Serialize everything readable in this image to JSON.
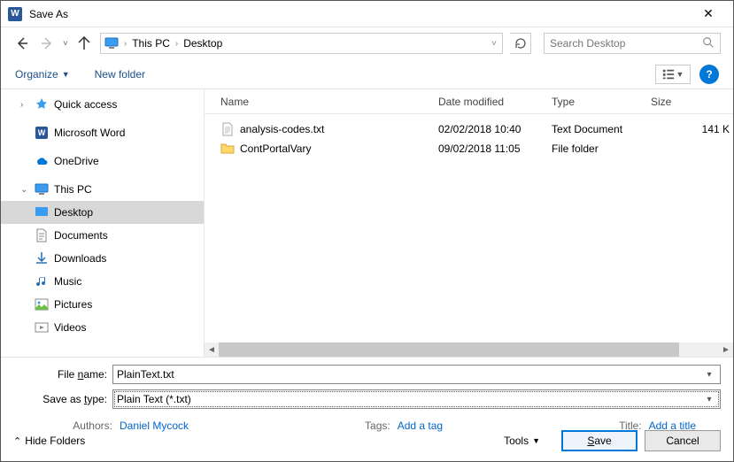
{
  "window": {
    "title": "Save As"
  },
  "nav": {
    "breadcrumb": [
      "This PC",
      "Desktop"
    ],
    "search_placeholder": "Search Desktop"
  },
  "toolbar": {
    "organize": "Organize",
    "newfolder": "New folder"
  },
  "sidebar": {
    "quickaccess": "Quick access",
    "word": "Microsoft Word",
    "onedrive": "OneDrive",
    "thispc": "This PC",
    "desktop": "Desktop",
    "documents": "Documents",
    "downloads": "Downloads",
    "music": "Music",
    "pictures": "Pictures",
    "videos": "Videos"
  },
  "columns": {
    "name": "Name",
    "date": "Date modified",
    "type": "Type",
    "size": "Size"
  },
  "files": [
    {
      "name": "analysis-codes.txt",
      "date": "02/02/2018 10:40",
      "type": "Text Document",
      "size": "141 K",
      "icon": "text"
    },
    {
      "name": "ContPortalVary",
      "date": "09/02/2018 11:05",
      "type": "File folder",
      "size": "",
      "icon": "folder"
    }
  ],
  "form": {
    "filename_label_pre": "File ",
    "filename_label_ul": "n",
    "filename_label_post": "ame:",
    "filename_value": "PlainText.txt",
    "savetype_label_pre": "Save as ",
    "savetype_label_ul": "t",
    "savetype_label_post": "ype:",
    "savetype_value": "Plain Text (*.txt)"
  },
  "meta": {
    "authors_label": "Authors:",
    "authors_value": "Daniel Mycock",
    "tags_label": "Tags:",
    "tags_value": "Add a tag",
    "title_label": "Title:",
    "title_value": "Add a title"
  },
  "footer": {
    "hidefolders": "Hide Folders",
    "tools": "Tools",
    "save_pre": "",
    "save_ul": "S",
    "save_post": "ave",
    "cancel": "Cancel"
  }
}
